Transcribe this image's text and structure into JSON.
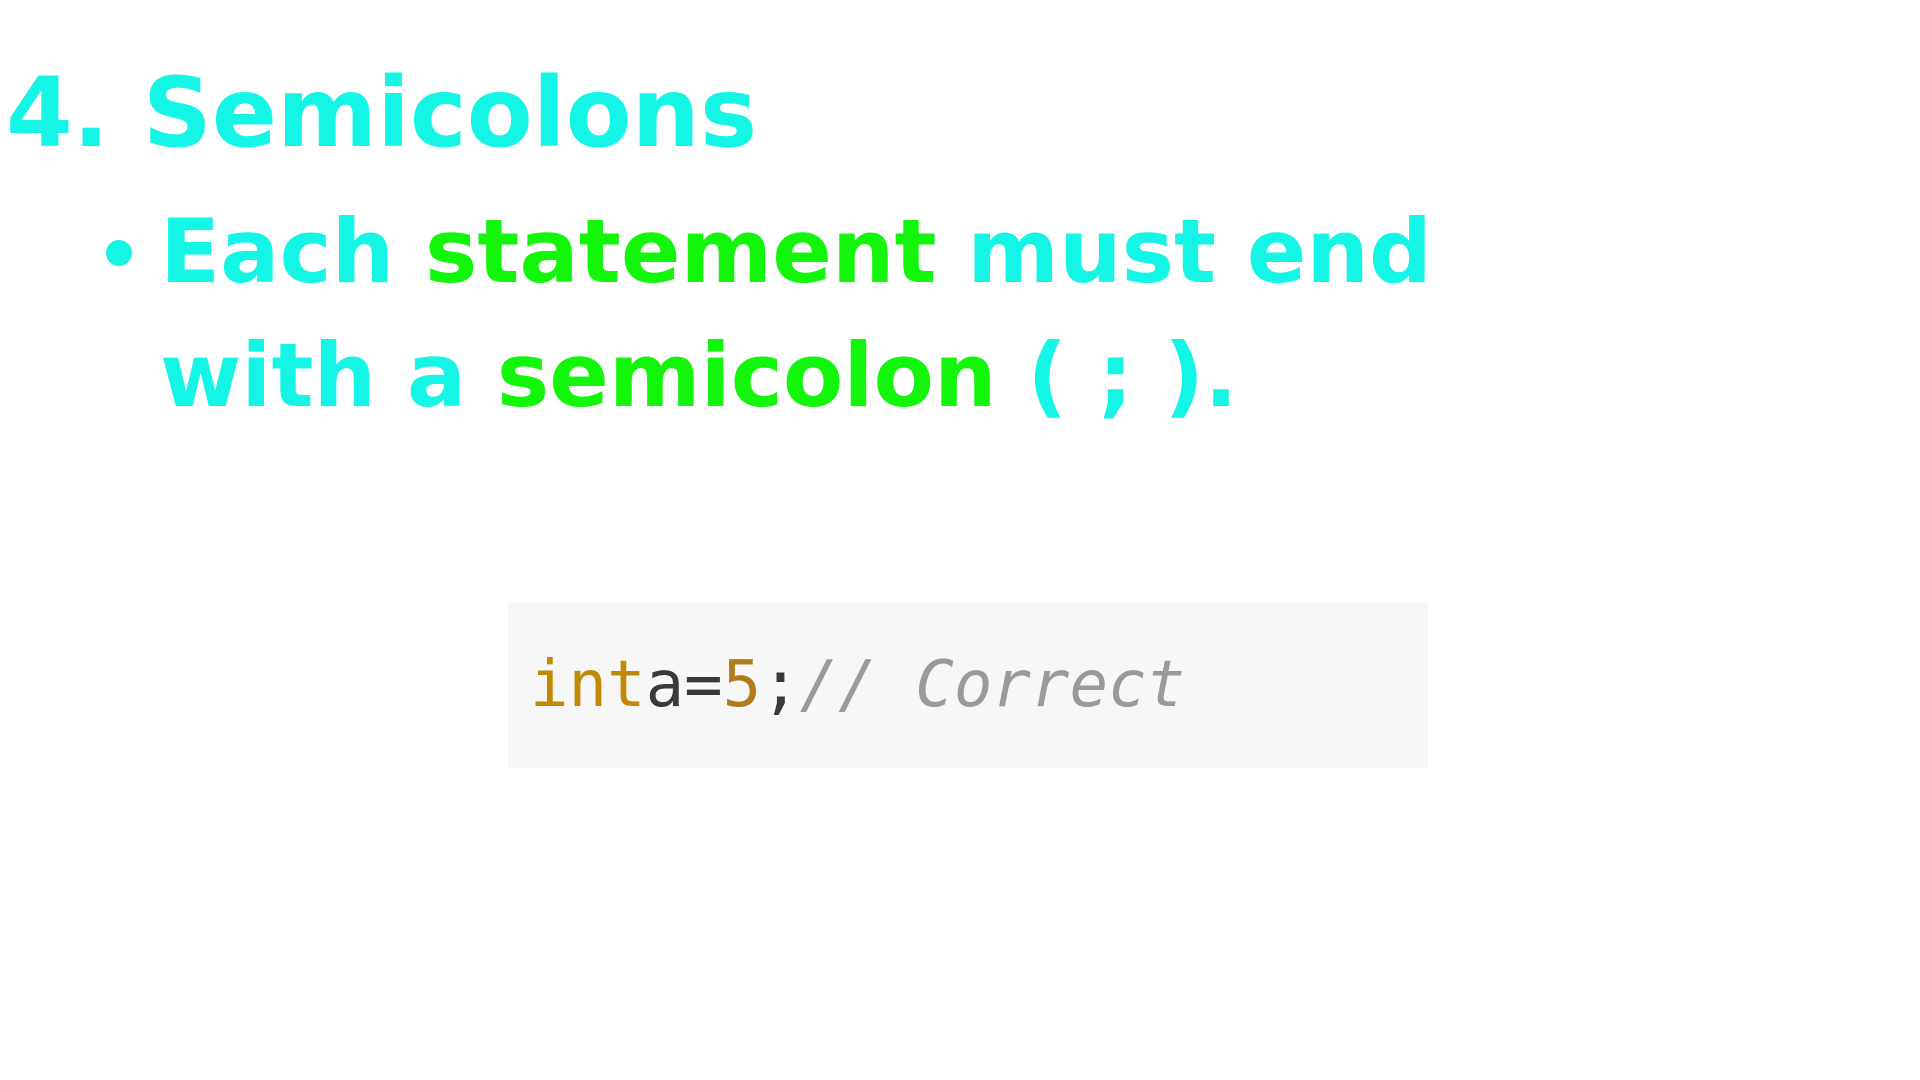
{
  "slide": {
    "heading": "4. Semicolons",
    "bullet": {
      "part1": "Each ",
      "part2_highlight": "statement",
      "part3": " must end with a ",
      "part4_highlight": "semicolon",
      "part5": " ( ; )."
    },
    "code": {
      "keyword": "int",
      "identifier": "a",
      "operator": "=",
      "number": "5",
      "terminator": ";",
      "comment": "// Correct"
    }
  },
  "colors": {
    "heading": "#14f5e6",
    "highlight_green": "#13f50b",
    "code_keyword": "#c18a06",
    "code_number": "#b07c1c",
    "code_comment": "#9a9a9a",
    "code_background": "#f7f7f7"
  }
}
